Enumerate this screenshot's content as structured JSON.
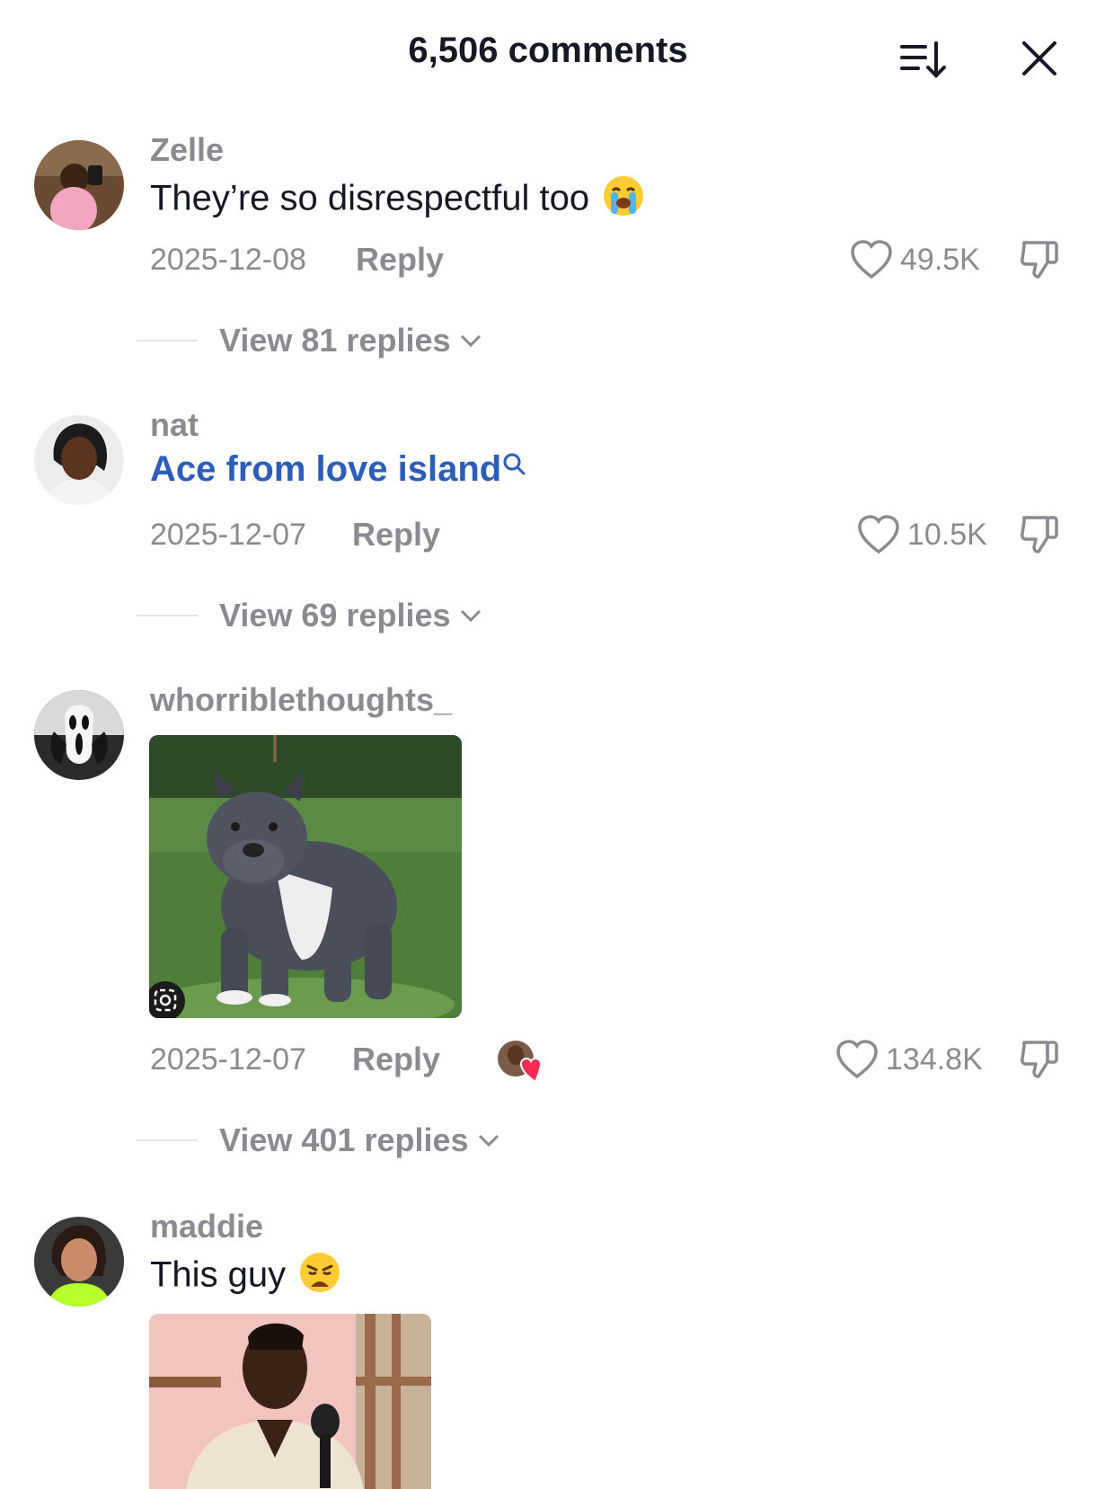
{
  "header": {
    "title": "6,506 comments"
  },
  "comments": [
    {
      "username": "Zelle",
      "text": "They’re so disrespectful too",
      "emoji": "crying-face",
      "date": "2025-12-08",
      "reply_label": "Reply",
      "likes": "49.5K",
      "view_replies": "View 81 replies"
    },
    {
      "username": "nat",
      "text": "Ace from love island",
      "date": "2025-12-07",
      "reply_label": "Reply",
      "likes": "10.5K",
      "view_replies": "View 69 replies"
    },
    {
      "username": "whorriblethoughts_",
      "date": "2025-12-07",
      "reply_label": "Reply",
      "likes": "134.8K",
      "view_replies": "View 401 replies"
    },
    {
      "username": "maddie",
      "text": "This guy",
      "emoji": "weary-face"
    }
  ],
  "colors": {
    "link": "#2b5db9",
    "muted": "#8a8b91",
    "text": "#161823",
    "heart_badge": "#fe2c55"
  }
}
